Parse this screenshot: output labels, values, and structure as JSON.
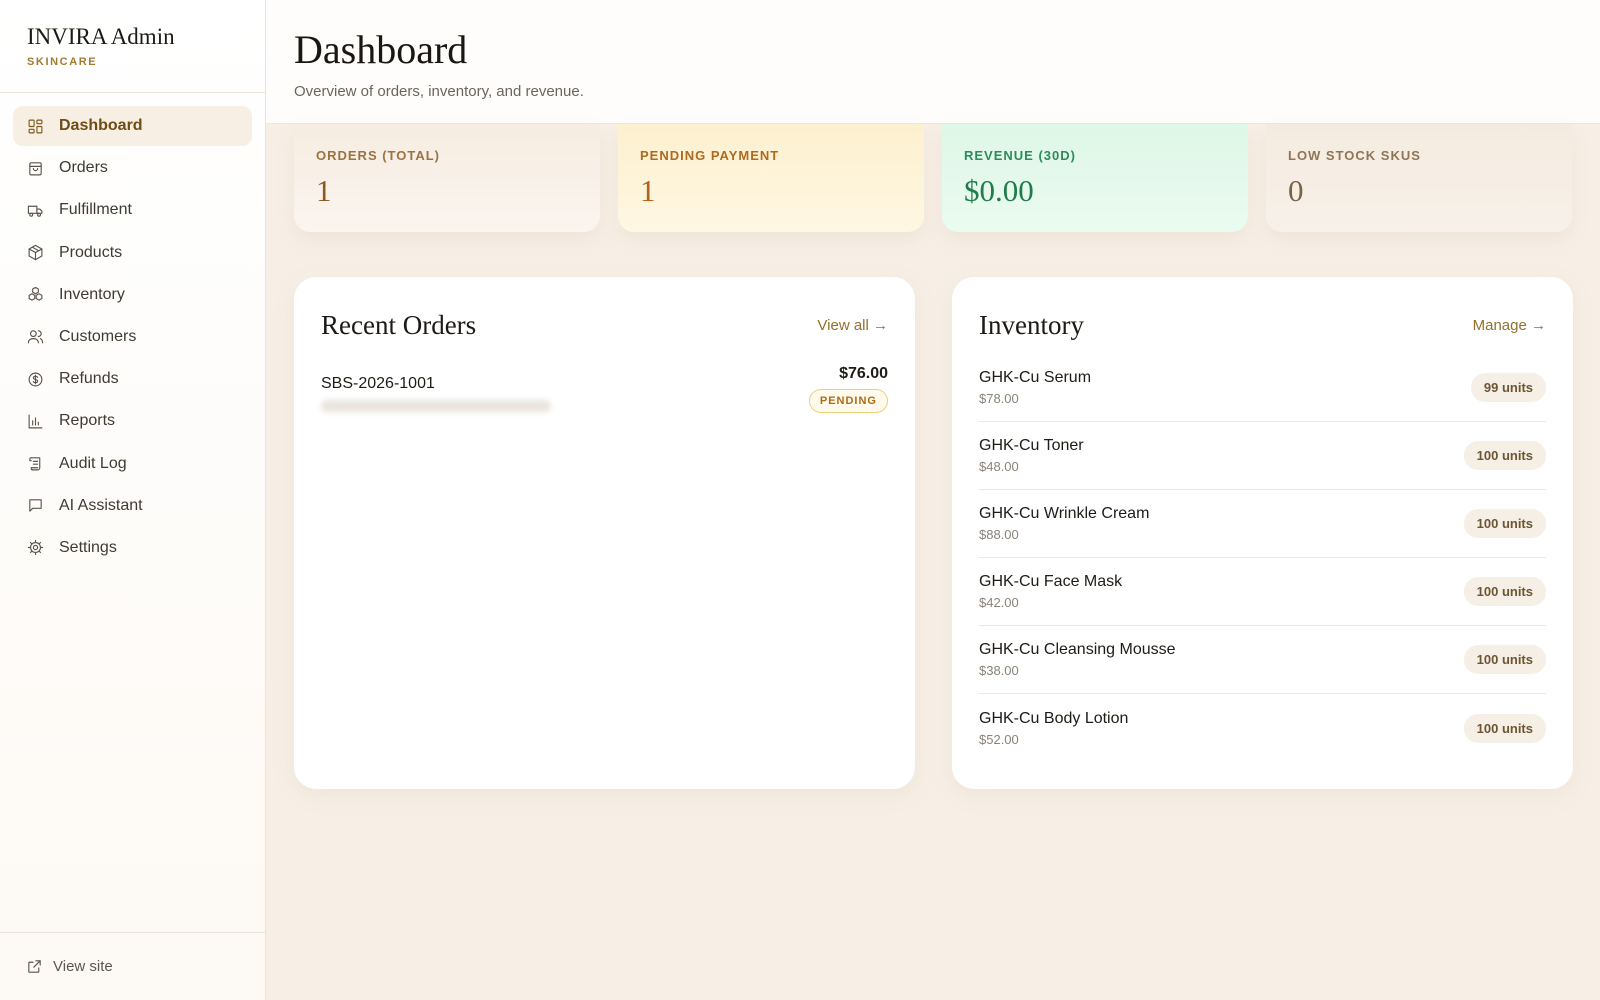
{
  "brand": {
    "title": "INVIRA Admin",
    "subtitle": "SKINCARE"
  },
  "sidebar": {
    "items": [
      {
        "label": "Dashboard",
        "icon": "dashboard-icon",
        "active": true
      },
      {
        "label": "Orders",
        "icon": "shopping-bag-icon"
      },
      {
        "label": "Fulfillment",
        "icon": "truck-icon"
      },
      {
        "label": "Products",
        "icon": "box-icon"
      },
      {
        "label": "Inventory",
        "icon": "boxes-icon"
      },
      {
        "label": "Customers",
        "icon": "users-icon"
      },
      {
        "label": "Refunds",
        "icon": "dollar-circle-icon"
      },
      {
        "label": "Reports",
        "icon": "bar-chart-icon"
      },
      {
        "label": "Audit Log",
        "icon": "scroll-icon"
      },
      {
        "label": "AI Assistant",
        "icon": "chat-icon"
      },
      {
        "label": "Settings",
        "icon": "gear-icon"
      }
    ],
    "footer_label": "View site"
  },
  "header": {
    "title": "Dashboard",
    "subtitle": "Overview of orders, inventory, and revenue."
  },
  "stats": [
    {
      "label": "ORDERS (TOTAL)",
      "value": "1"
    },
    {
      "label": "PENDING PAYMENT",
      "value": "1"
    },
    {
      "label": "REVENUE (30D)",
      "value": "$0.00"
    },
    {
      "label": "LOW STOCK SKUS",
      "value": "0"
    }
  ],
  "recent_orders": {
    "title": "Recent Orders",
    "link": "View all →",
    "orders": [
      {
        "id": "SBS-2026-1001",
        "amount": "$76.00",
        "status": "PENDING"
      }
    ]
  },
  "inventory": {
    "title": "Inventory",
    "link": "Manage →",
    "items": [
      {
        "name": "GHK-Cu Serum",
        "price": "$78.00",
        "stock": "99 units"
      },
      {
        "name": "GHK-Cu Toner",
        "price": "$48.00",
        "stock": "100 units"
      },
      {
        "name": "GHK-Cu Wrinkle Cream",
        "price": "$88.00",
        "stock": "100 units"
      },
      {
        "name": "GHK-Cu Face Mask",
        "price": "$42.00",
        "stock": "100 units"
      },
      {
        "name": "GHK-Cu Cleansing Mousse",
        "price": "$38.00",
        "stock": "100 units"
      },
      {
        "name": "GHK-Cu Body Lotion",
        "price": "$52.00",
        "stock": "100 units"
      }
    ]
  },
  "colors": {
    "accent": "#a27c2d",
    "background": "#f7efe6",
    "pending": "#b06a14",
    "revenue": "#1f7c4b"
  }
}
